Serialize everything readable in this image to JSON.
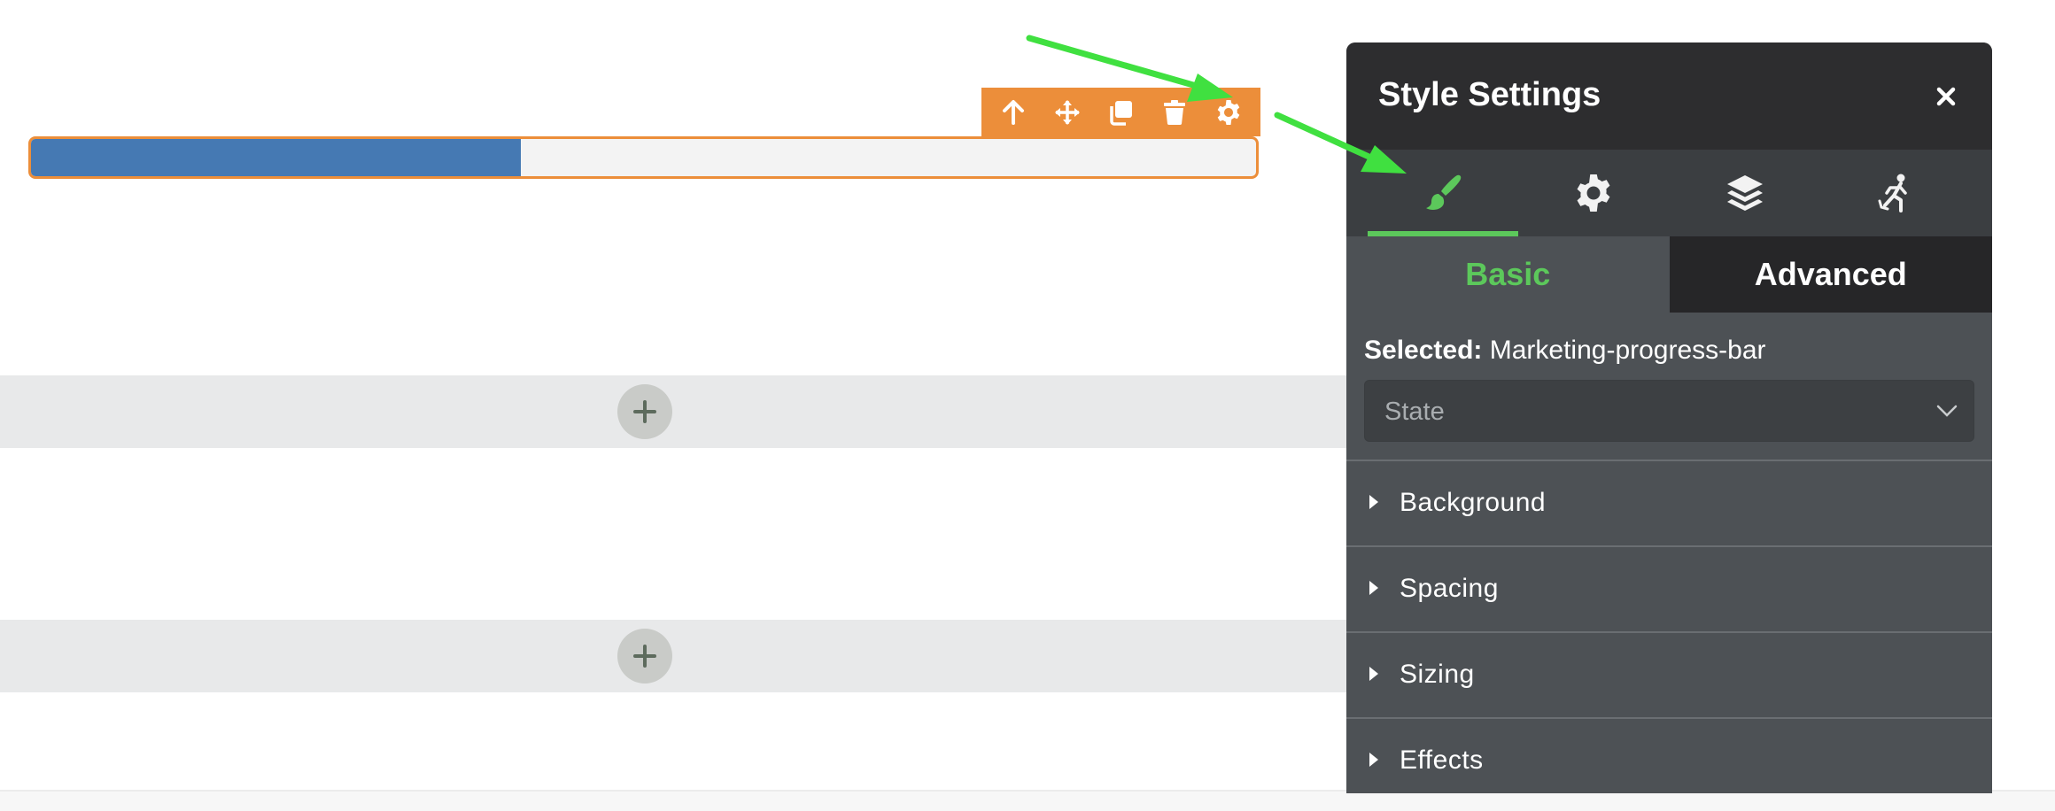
{
  "canvas": {
    "progress_bar": {
      "value_percent": 40,
      "fill_color": "#4579b3",
      "track_color": "#f3f3f3",
      "outline_color": "#ec8e3a"
    },
    "toolbar": {
      "color": "#ec8e3a",
      "buttons": [
        {
          "icon": "arrow-up-icon",
          "name": "select-parent-button"
        },
        {
          "icon": "move-icon",
          "name": "move-button"
        },
        {
          "icon": "duplicate-icon",
          "name": "duplicate-button"
        },
        {
          "icon": "trash-icon",
          "name": "delete-button"
        },
        {
          "icon": "gear-icon",
          "name": "settings-button"
        }
      ]
    },
    "add_buttons": [
      {
        "icon": "plus-icon"
      },
      {
        "icon": "plus-icon"
      }
    ],
    "annotation_color": "#40e040"
  },
  "panel": {
    "title": "Style Settings",
    "close_label": "×",
    "icon_tabs": [
      {
        "icon": "brush-icon",
        "active": true
      },
      {
        "icon": "gear-icon",
        "active": false
      },
      {
        "icon": "layers-icon",
        "active": false
      },
      {
        "icon": "interaction-icon",
        "active": false
      }
    ],
    "sub_tabs": {
      "basic": "Basic",
      "advanced": "Advanced"
    },
    "selected_label": "Selected:",
    "selected_value": "Marketing-progress-bar",
    "state_placeholder": "State",
    "sections": [
      "Background",
      "Spacing",
      "Sizing",
      "Effects"
    ],
    "accent_color": "#5cc85b"
  }
}
